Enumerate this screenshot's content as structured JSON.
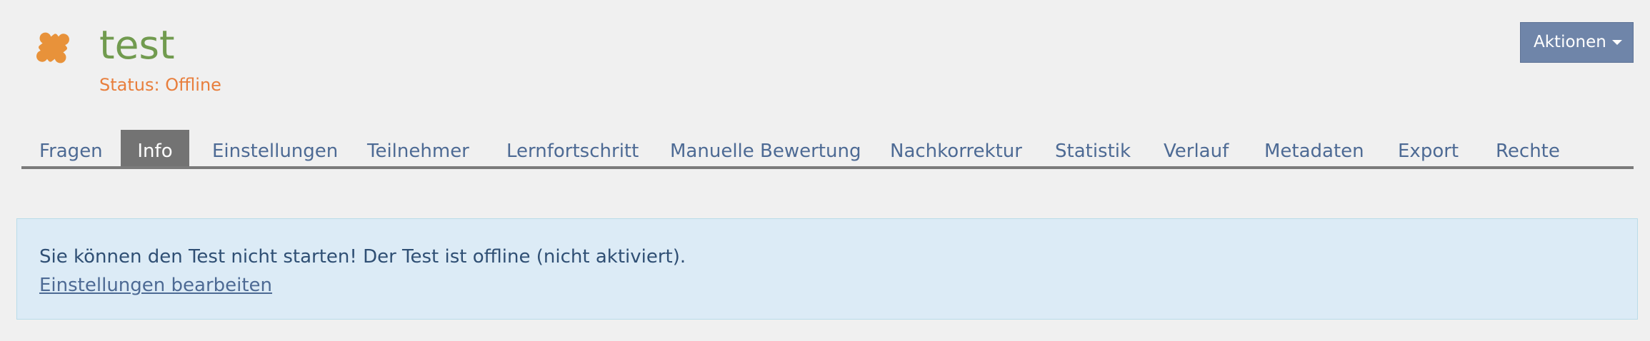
{
  "header": {
    "icon": "puzzle-piece-icon",
    "icon_color": "#e8923a",
    "title": "test",
    "status": "Status: Offline",
    "actions_label": "Aktionen"
  },
  "tabs": [
    {
      "label": "Fragen",
      "active": false
    },
    {
      "label": "Info",
      "active": true
    },
    {
      "label": "Einstellungen",
      "active": false
    },
    {
      "label": "Teilnehmer",
      "active": false
    },
    {
      "label": "Lernfortschritt",
      "active": false
    },
    {
      "label": "Manuelle Bewertung",
      "active": false
    },
    {
      "label": "Nachkorrektur",
      "active": false
    },
    {
      "label": "Statistik",
      "active": false
    },
    {
      "label": "Verlauf",
      "active": false
    },
    {
      "label": "Metadaten",
      "active": false
    },
    {
      "label": "Export",
      "active": false
    },
    {
      "label": "Rechte",
      "active": false
    }
  ],
  "message": {
    "text": "Sie können den Test nicht starten! Der Test ist offline (nicht aktiviert).",
    "link": "Einstellungen bearbeiten"
  },
  "colors": {
    "title": "#719b4f",
    "status": "#e87e3c",
    "link": "#4d6a94",
    "active_tab": "#737373",
    "actions_button": "#6f85a9",
    "message_background": "#dcebf6"
  }
}
